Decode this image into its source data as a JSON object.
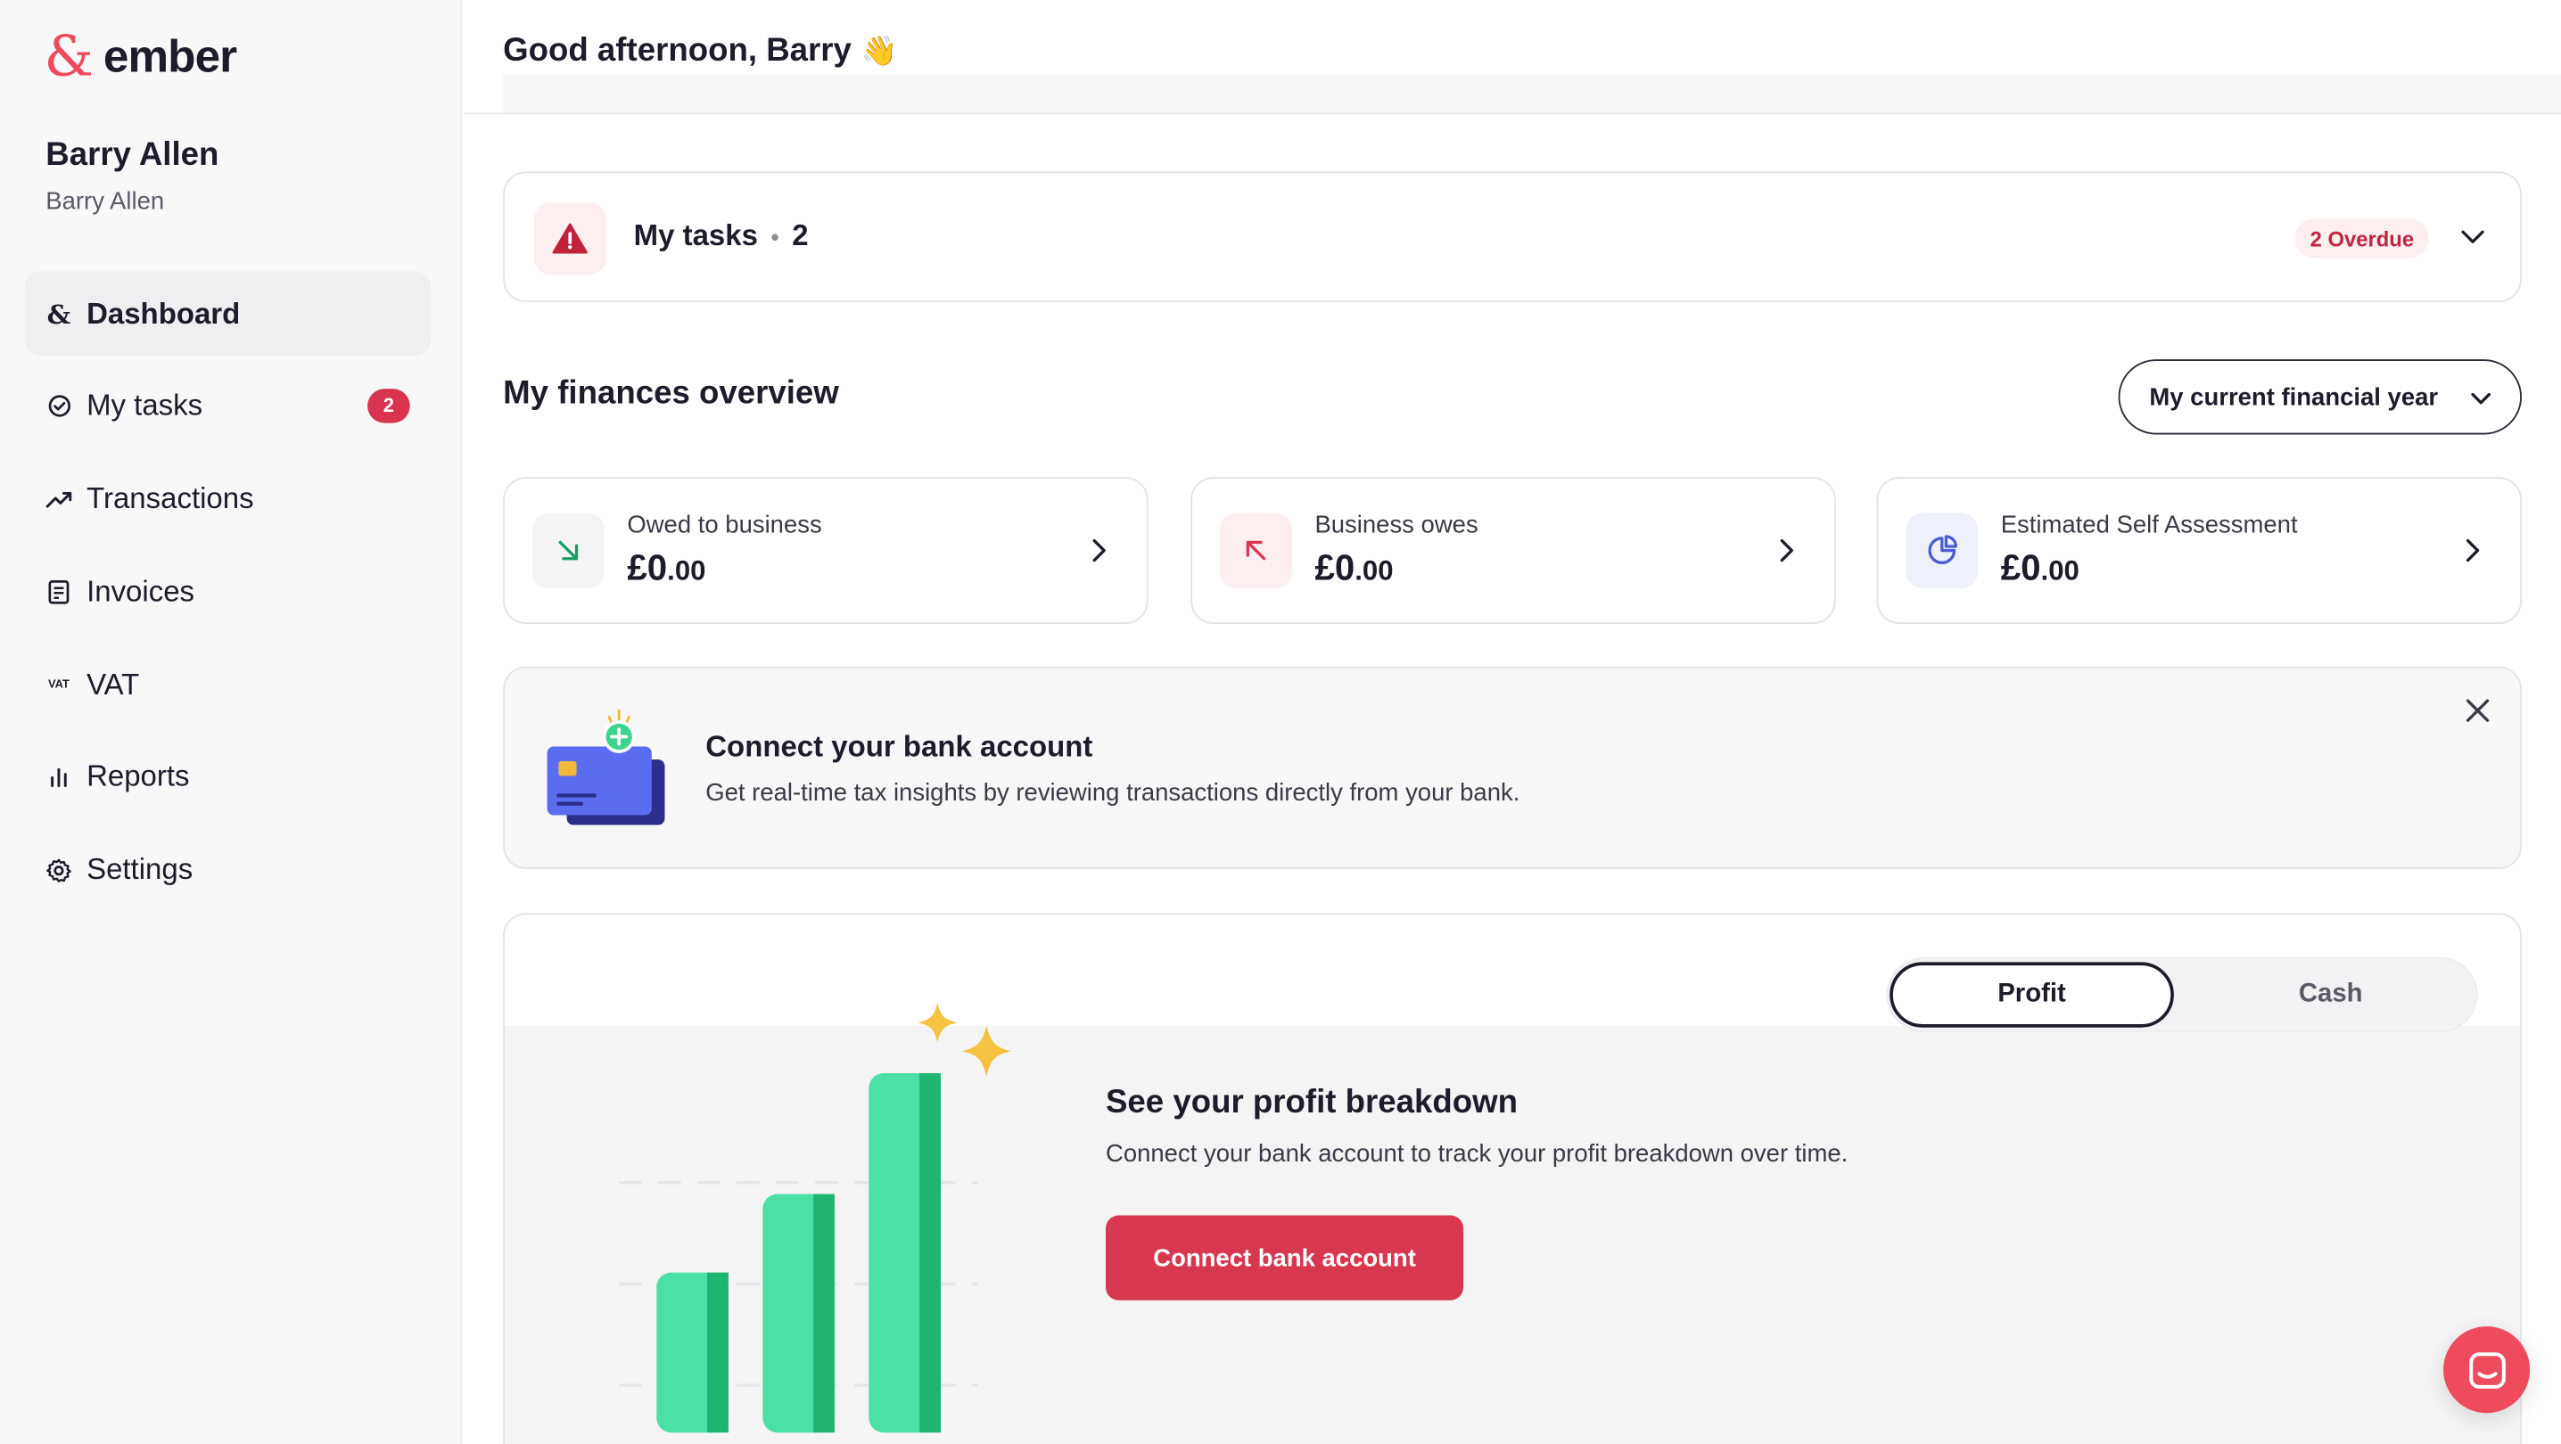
{
  "brand": {
    "mark": "&",
    "name": "ember",
    "accent": "#f0495b"
  },
  "user": {
    "name": "Barry Allen",
    "subtitle": "Barry Allen"
  },
  "nav": [
    {
      "label": "Dashboard",
      "icon": "ampersand-icon",
      "active": true
    },
    {
      "label": "My tasks",
      "icon": "check-circle-icon",
      "badge": "2"
    },
    {
      "label": "Transactions",
      "icon": "trend-up-icon"
    },
    {
      "label": "Invoices",
      "icon": "invoice-icon"
    },
    {
      "label": "VAT",
      "icon": "vat-icon",
      "icon_text": "VAT"
    },
    {
      "label": "Reports",
      "icon": "bar-chart-icon"
    },
    {
      "label": "Settings",
      "icon": "gear-icon"
    }
  ],
  "header": {
    "greeting": "Good afternoon, Barry",
    "emoji": "👋"
  },
  "tasks": {
    "title": "My tasks",
    "separator": "•",
    "count": "2",
    "overdue": "2 Overdue"
  },
  "finances": {
    "title": "My finances overview",
    "period": "My current financial year",
    "cards": [
      {
        "label": "Owed to business",
        "value_main": "£0",
        "value_pence": ".00",
        "icon": "arrow-down-right-icon"
      },
      {
        "label": "Business owes",
        "value_main": "£0",
        "value_pence": ".00",
        "icon": "arrow-up-left-icon"
      },
      {
        "label": "Estimated Self Assessment",
        "value_main": "£0",
        "value_pence": ".00",
        "icon": "pie-chart-icon"
      }
    ]
  },
  "bank_prompt": {
    "title": "Connect your bank account",
    "description": "Get real-time tax insights by reviewing transactions directly from your bank."
  },
  "profit": {
    "toggle": {
      "options": [
        "Profit",
        "Cash"
      ],
      "selected": "Profit"
    },
    "title": "See your profit breakdown",
    "description": "Connect your bank account to track your profit breakdown over time.",
    "button": "Connect bank account"
  }
}
